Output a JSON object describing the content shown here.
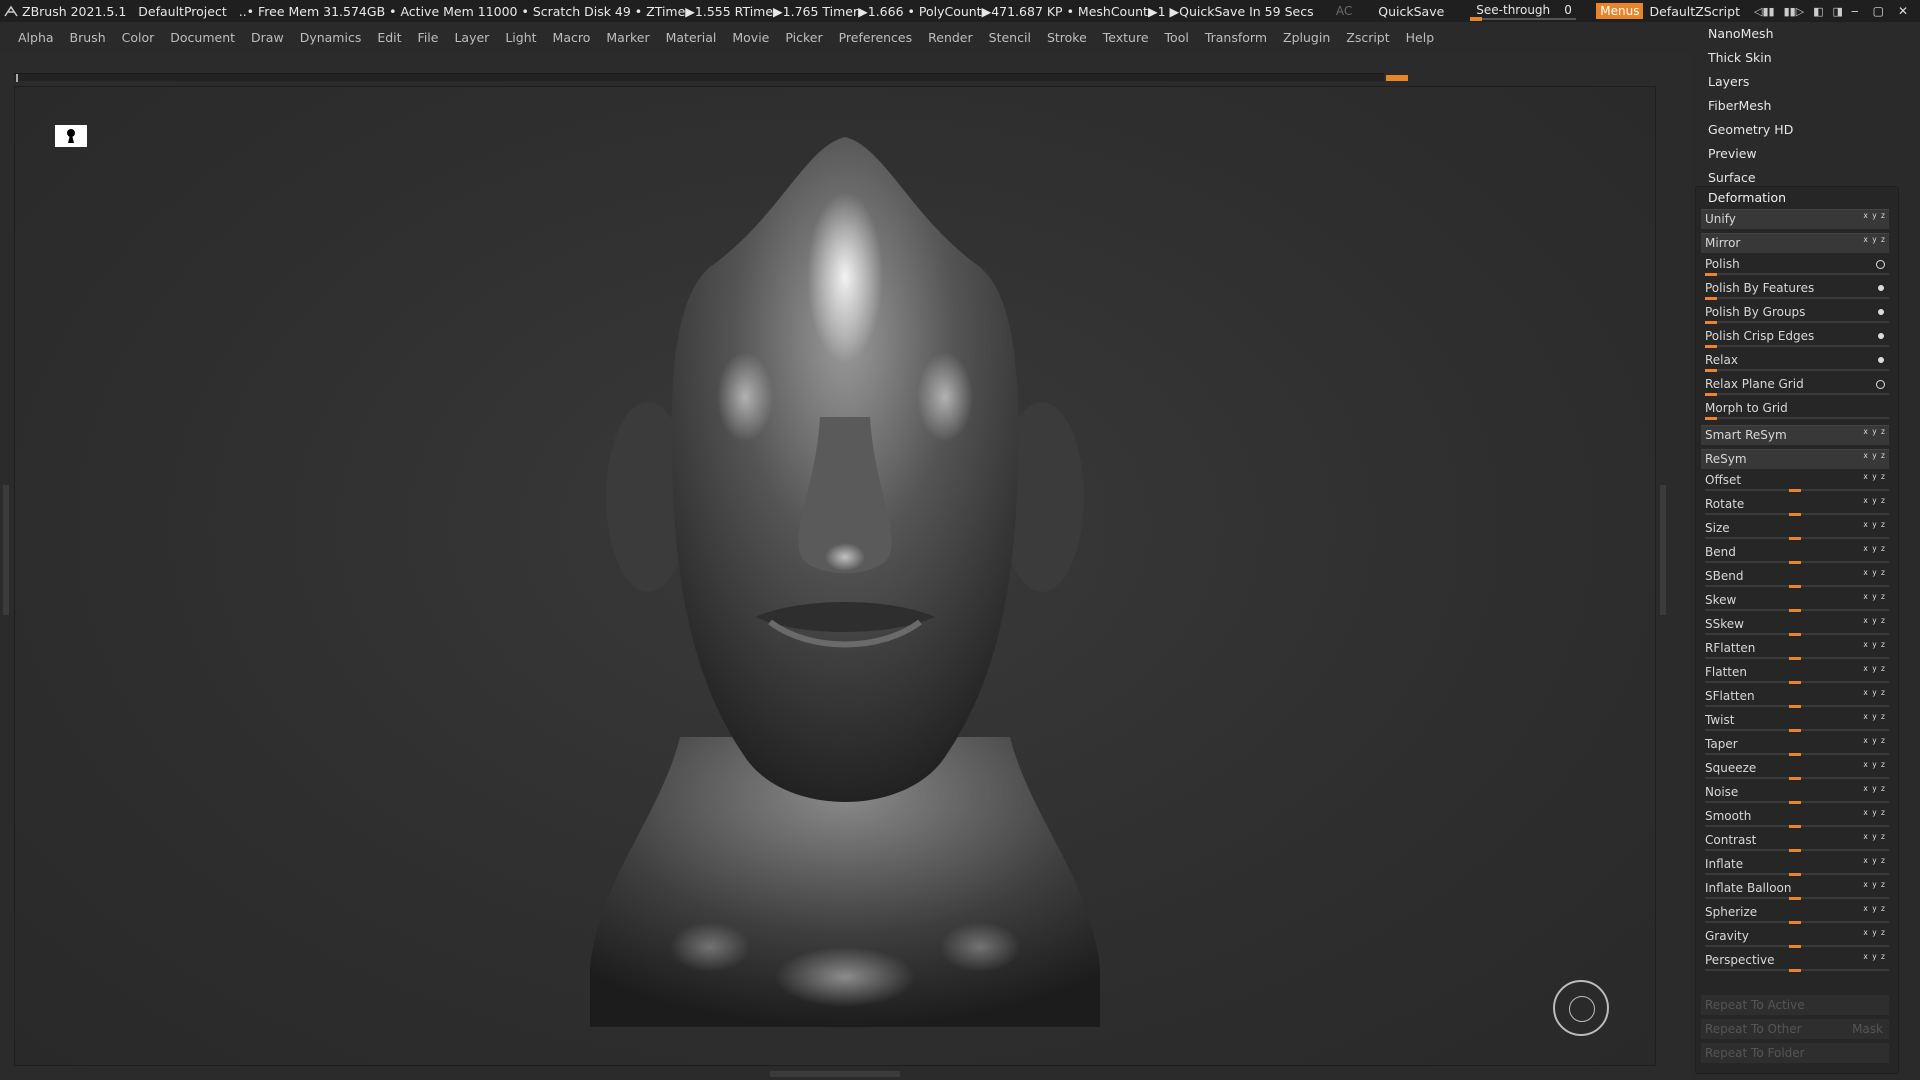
{
  "titlebar": {
    "app": "ZBrush 2021.5.1",
    "project": "DefaultProject",
    "stats": "..• Free Mem 31.574GB • Active Mem 11000 • Scratch Disk 49 •  ZTime▶1.555 RTime▶1.765 Timer▶1.666 • PolyCount▶471.687 KP  • MeshCount▶1  ▶QuickSave In 59 Secs",
    "ac": "AC",
    "quicksave": "QuickSave",
    "seethrough_label": "See-through",
    "seethrough_value": "0",
    "seethrough_level": 0,
    "menus": "Menus",
    "script": "DefaultZScript"
  },
  "menubar": [
    "Alpha",
    "Brush",
    "Color",
    "Document",
    "Draw",
    "Dynamics",
    "Edit",
    "File",
    "Layer",
    "Light",
    "Macro",
    "Marker",
    "Material",
    "Movie",
    "Picker",
    "Preferences",
    "Render",
    "Stencil",
    "Stroke",
    "Texture",
    "Tool",
    "Transform",
    "Zplugin",
    "Zscript",
    "Help"
  ],
  "panel": {
    "sections": [
      "NanoMesh",
      "Thick Skin",
      "Layers",
      "FiberMesh",
      "Geometry HD",
      "Preview",
      "Surface"
    ],
    "deformation_title": "Deformation",
    "buttons": {
      "unify": "Unify",
      "mirror": "Mirror",
      "polish": "Polish",
      "polish_features": "Polish By Features",
      "polish_groups": "Polish By Groups",
      "polish_crisp": "Polish Crisp Edges",
      "relax": "Relax",
      "relax_plane": "Relax Plane Grid",
      "morph_grid": "Morph to Grid",
      "smart_resym": "Smart ReSym",
      "resym": "ReSym"
    },
    "sliders": [
      "Offset",
      "Rotate",
      "Size",
      "Bend",
      "SBend",
      "Skew",
      "SSkew",
      "RFlatten",
      "Flatten",
      "SFlatten",
      "Twist",
      "Taper",
      "Squeeze",
      "Noise",
      "Smooth",
      "Contrast",
      "Inflate",
      "Inflate Balloon",
      "Spherize",
      "Gravity",
      "Perspective"
    ],
    "repeat_active": "Repeat To Active",
    "repeat_other": "Repeat To Other",
    "mask": "Mask",
    "repeat_folder": "Repeat To Folder",
    "xyz": "x y z"
  },
  "colors": {
    "accent": "#e8842a",
    "panel": "#2a2a2a",
    "canvas": "#303030"
  }
}
